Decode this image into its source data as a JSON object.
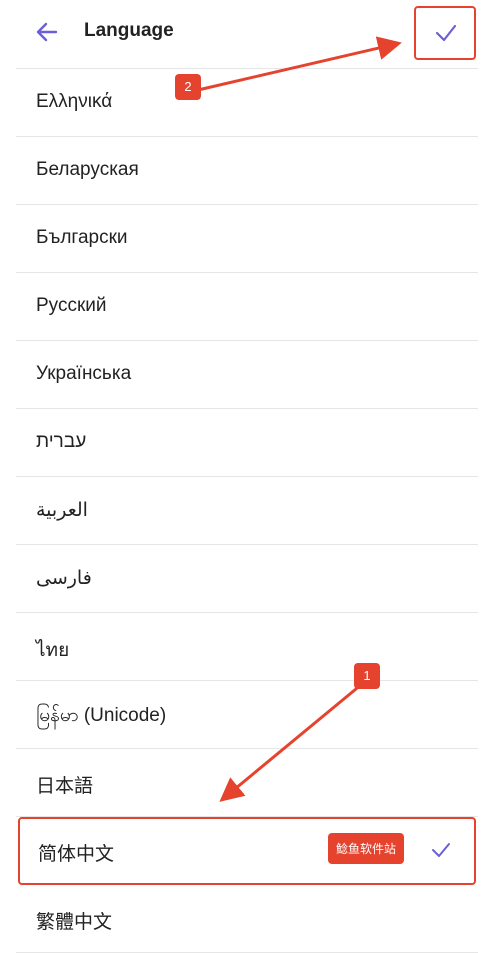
{
  "header": {
    "title": "Language",
    "back_icon": "arrow-left-icon",
    "done_icon": "check-icon",
    "accent_color": "#6b5fd6"
  },
  "languages": [
    {
      "label": "Ελληνικά",
      "selected": false
    },
    {
      "label": "Беларуская",
      "selected": false
    },
    {
      "label": "Български",
      "selected": false
    },
    {
      "label": "Русский",
      "selected": false
    },
    {
      "label": "Українська",
      "selected": false
    },
    {
      "label": "עברית",
      "selected": false
    },
    {
      "label": "العربية",
      "selected": false
    },
    {
      "label": "فارسی",
      "selected": false
    },
    {
      "label": "ไทย",
      "selected": false
    },
    {
      "label": "မြန်မာ (Unicode)",
      "selected": false
    },
    {
      "label": "日本語",
      "selected": false
    },
    {
      "label": "简体中文",
      "selected": true
    },
    {
      "label": "繁體中文",
      "selected": false
    }
  ],
  "watermark": "鲶鱼软件站",
  "annotations": {
    "step1": "1",
    "step2": "2",
    "highlight_color": "#e5432e"
  }
}
